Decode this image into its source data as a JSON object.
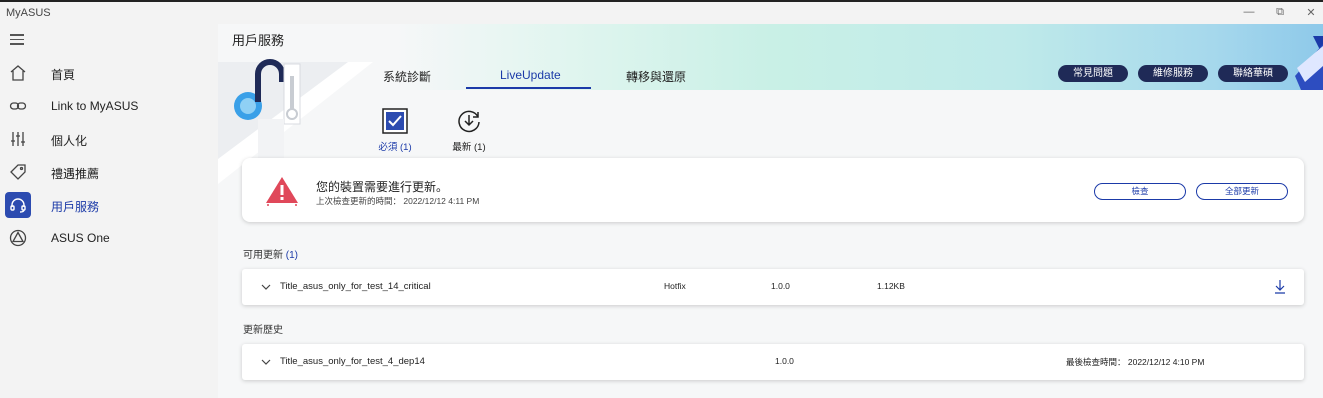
{
  "app": {
    "title": "MyASUS"
  },
  "window": {
    "minimize": "—",
    "maximize": "⧉",
    "close": "✕"
  },
  "sidebar": {
    "items": [
      {
        "label": "首頁",
        "icon": "home-icon"
      },
      {
        "label": "Link to MyASUS",
        "icon": "link-icon"
      },
      {
        "label": "個人化",
        "icon": "sliders-icon"
      },
      {
        "label": "禮遇推薦",
        "icon": "tag-icon"
      },
      {
        "label": "用戶服務",
        "icon": "headset-icon",
        "active": true
      },
      {
        "label": "ASUS One",
        "icon": "asus-one-icon"
      }
    ]
  },
  "page": {
    "title": "用戶服務"
  },
  "tabs": [
    {
      "label": "系統診斷"
    },
    {
      "label": "LiveUpdate",
      "active": true
    },
    {
      "label": "轉移與還原"
    }
  ],
  "top_buttons": [
    {
      "label": "常見問題"
    },
    {
      "label": "維修服務"
    },
    {
      "label": "聯絡華碩"
    }
  ],
  "filters": [
    {
      "label": "必須 (1)",
      "icon": "checkbox-checked-icon",
      "active": true
    },
    {
      "label": "最新 (1)",
      "icon": "download-refresh-icon"
    }
  ],
  "alert": {
    "title": "您的裝置需要進行更新。",
    "last_check": "上次檢查更新的時間： 2022/12/12  4:11 PM",
    "check_button": "檢查",
    "update_all_button": "全部更新"
  },
  "available": {
    "label": "可用更新",
    "count": "(1)",
    "rows": [
      {
        "title": "Title_asus_only_for_test_14_critical",
        "type": "Hotfix",
        "version": "1.0.0",
        "size": "1.12KB"
      }
    ]
  },
  "history": {
    "label": "更新歷史",
    "rows": [
      {
        "title": "Title_asus_only_for_test_4_dep14",
        "version": "1.0.0",
        "checked": "最後檢查時間： 2022/12/12  4:10 PM"
      }
    ]
  },
  "colors": {
    "accent": "#1b3aa8",
    "nav_active": "#2c4bb0",
    "pill": "#1f2a57",
    "warning": "#e0485a"
  }
}
